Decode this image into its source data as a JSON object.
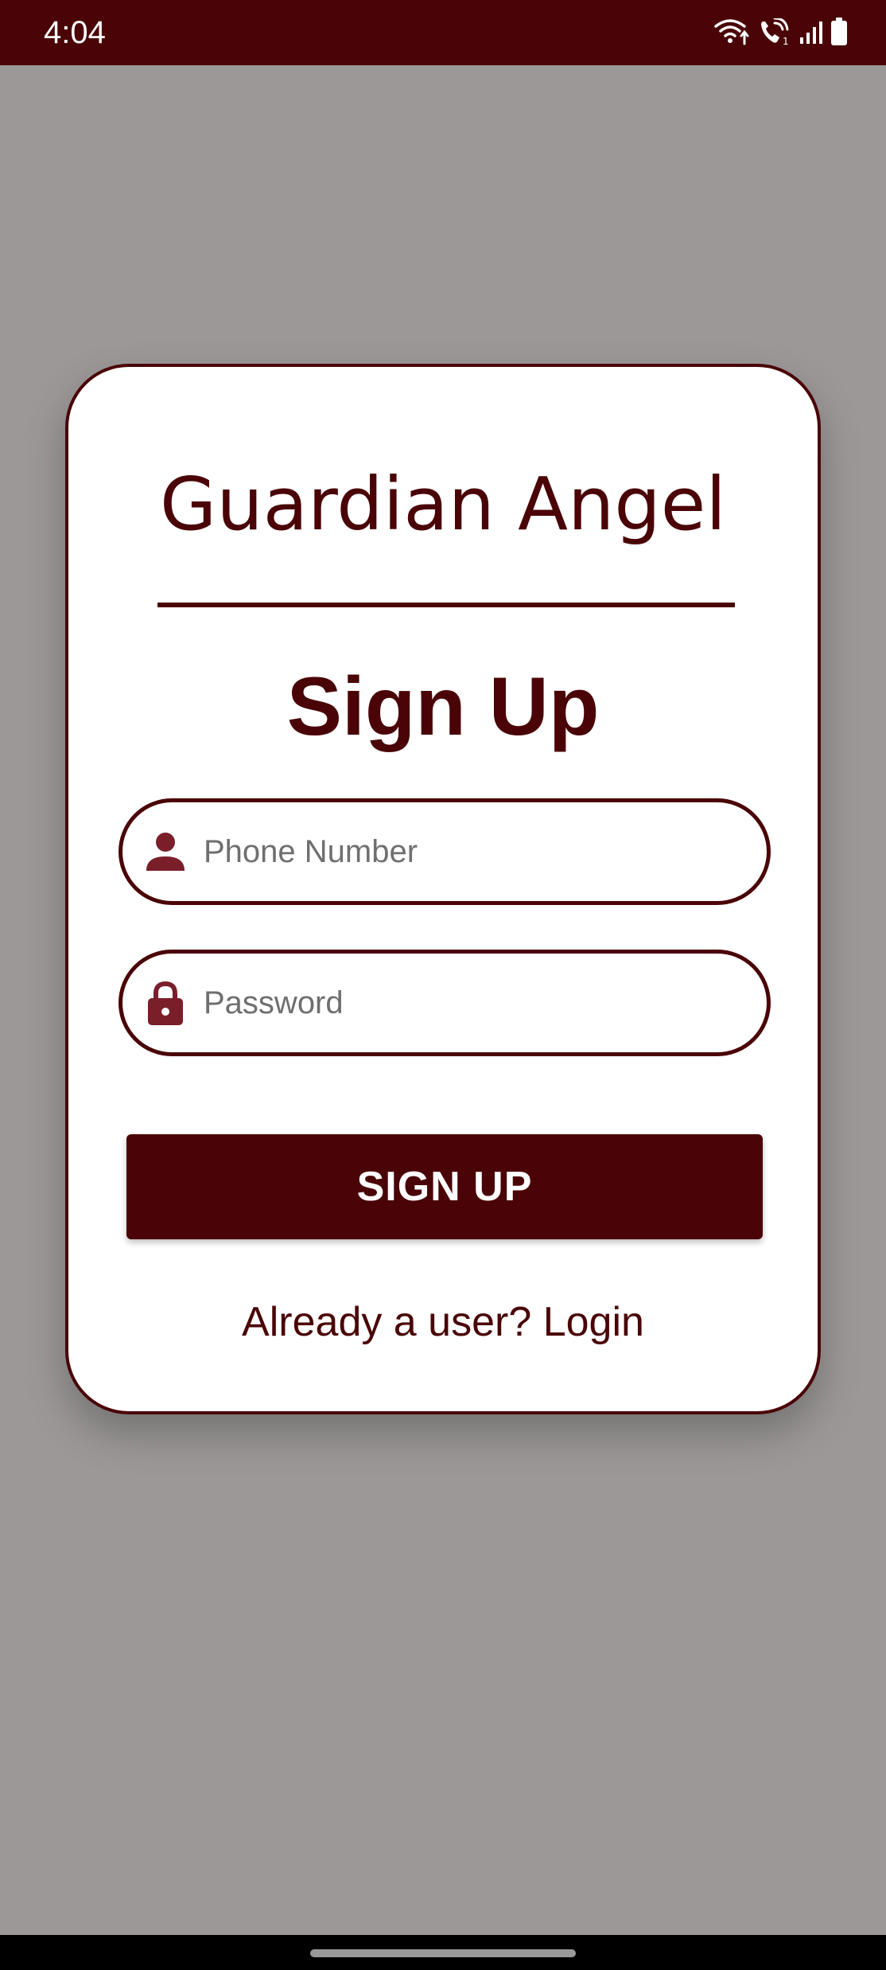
{
  "status_bar": {
    "time": "4:04",
    "icons": [
      "wifi-calling-icon",
      "volte-call-icon",
      "signal-icon",
      "battery-icon"
    ]
  },
  "card": {
    "app_title": "Guardian Angel",
    "heading": "Sign Up"
  },
  "form": {
    "phone": {
      "placeholder": "Phone Number",
      "icon": "person-icon"
    },
    "password": {
      "placeholder": "Password",
      "icon": "lock-icon"
    },
    "submit_label": "SIGN UP",
    "login_link": "Already a user? Login"
  },
  "colors": {
    "primary": "#4a0306",
    "scrim": "#9c9898",
    "card_bg": "#ffffff"
  }
}
